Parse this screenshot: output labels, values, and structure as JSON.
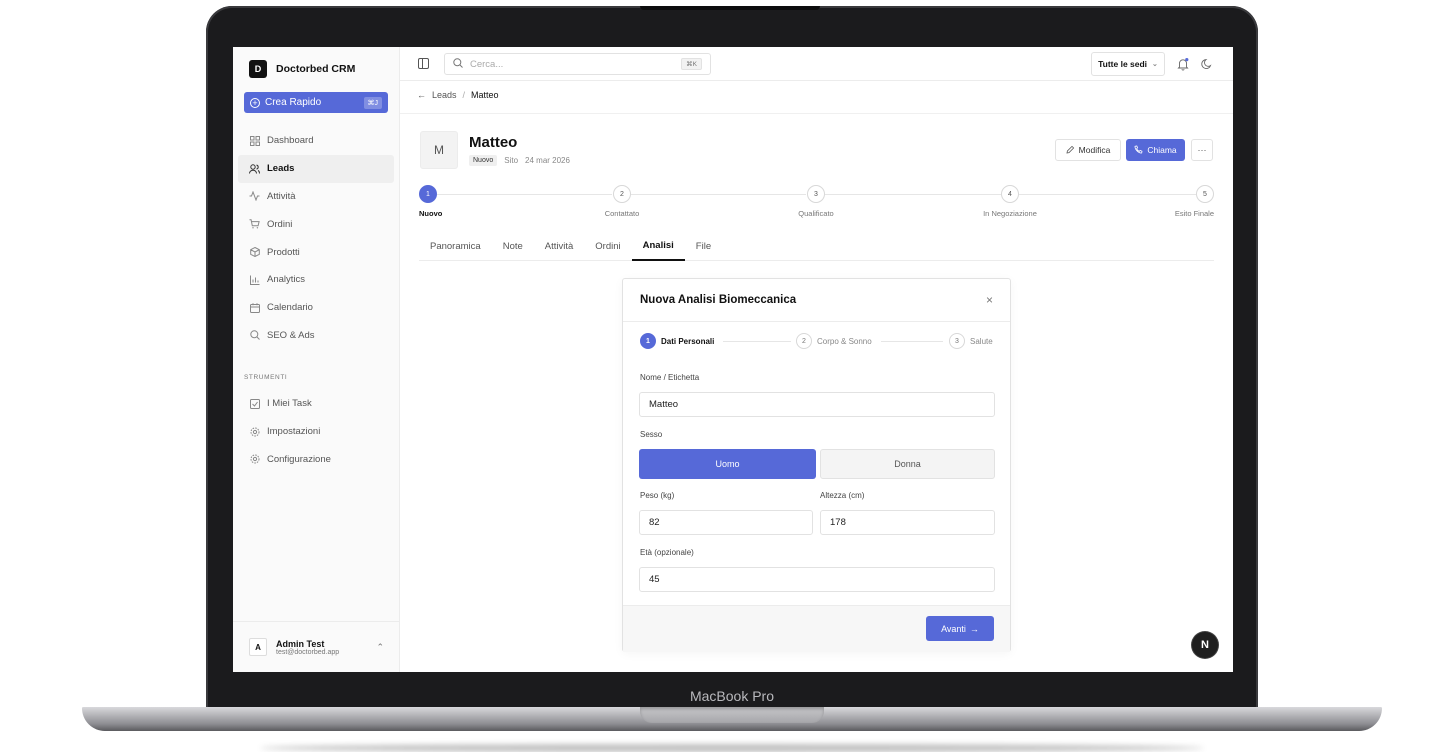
{
  "device": {
    "label": "MacBook Pro"
  },
  "brand": {
    "logo_letter": "D",
    "name": "Doctorbed CRM"
  },
  "quick_create": {
    "label": "Crea Rapido",
    "shortcut": "⌘J"
  },
  "nav": [
    {
      "label": "Dashboard",
      "icon": "grid-icon",
      "active": false
    },
    {
      "label": "Leads",
      "icon": "users-icon",
      "active": true
    },
    {
      "label": "Attività",
      "icon": "activity-icon",
      "active": false
    },
    {
      "label": "Ordini",
      "icon": "cart-icon",
      "active": false
    },
    {
      "label": "Prodotti",
      "icon": "package-icon",
      "active": false
    },
    {
      "label": "Analytics",
      "icon": "bar-chart-icon",
      "active": false
    },
    {
      "label": "Calendario",
      "icon": "calendar-icon",
      "active": false
    },
    {
      "label": "SEO & Ads",
      "icon": "search-icon",
      "active": false
    }
  ],
  "tools_section": {
    "label": "STRUMENTI"
  },
  "tools": [
    {
      "label": "I Miei Task",
      "icon": "checkbox-icon"
    },
    {
      "label": "Impostazioni",
      "icon": "gear-icon"
    },
    {
      "label": "Configurazione",
      "icon": "gear-icon"
    }
  ],
  "user": {
    "initial": "A",
    "name": "Admin Test",
    "email": "test@doctorbed.app"
  },
  "topbar": {
    "search_placeholder": "Cerca...",
    "search_shortcut": "⌘K",
    "location_select": "Tutte le sedi"
  },
  "breadcrumb": {
    "parent": "Leads",
    "current": "Matteo"
  },
  "lead": {
    "initial": "M",
    "name": "Matteo",
    "status_badge": "Nuovo",
    "source": "Sito",
    "date": "24 mar 2026",
    "edit_label": "Modifica",
    "call_label": "Chiama",
    "more_label": "···"
  },
  "pipeline": [
    {
      "number": "1",
      "label": "Nuovo",
      "active": true
    },
    {
      "number": "2",
      "label": "Contattato",
      "active": false
    },
    {
      "number": "3",
      "label": "Qualificato",
      "active": false
    },
    {
      "number": "4",
      "label": "In Negoziazione",
      "active": false
    },
    {
      "number": "5",
      "label": "Esito Finale",
      "active": false
    }
  ],
  "tabs": [
    {
      "label": "Panoramica",
      "active": false
    },
    {
      "label": "Note",
      "active": false
    },
    {
      "label": "Attività",
      "active": false
    },
    {
      "label": "Ordini",
      "active": false
    },
    {
      "label": "Analisi",
      "active": true
    },
    {
      "label": "File",
      "active": false
    }
  ],
  "modal": {
    "title": "Nuova Analisi Biomeccanica",
    "close": "×",
    "steps": [
      {
        "number": "1",
        "label": "Dati Personali",
        "active": true
      },
      {
        "number": "2",
        "label": "Corpo & Sonno",
        "active": false
      },
      {
        "number": "3",
        "label": "Salute",
        "active": false
      }
    ],
    "name_label": "Nome / Etichetta",
    "name_value": "Matteo",
    "sex_label": "Sesso",
    "sex_male": "Uomo",
    "sex_female": "Donna",
    "weight_label": "Peso (kg)",
    "weight_value": "82",
    "height_label": "Altezza (cm)",
    "height_value": "178",
    "age_label": "Età (opzionale)",
    "age_value": "45",
    "next_label": "Avanti",
    "next_arrow": "→"
  },
  "dev_badge": {
    "letter": "N"
  },
  "colors": {
    "accent": "#5669d8",
    "sidebar_bg": "#fafafa",
    "dark": "#111111"
  }
}
